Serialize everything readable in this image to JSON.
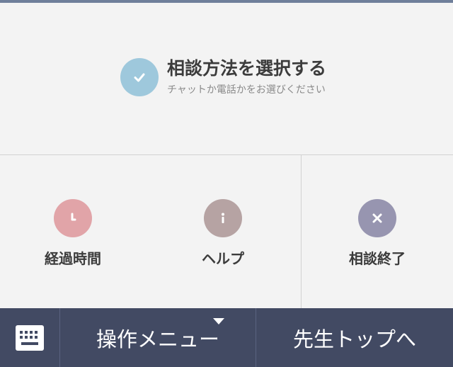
{
  "colors": {
    "check": "#9ec8dc",
    "elapsed": "#e1a4a8",
    "help": "#b6a3a3",
    "end": "#9795b0",
    "bottom_bar": "#424a63"
  },
  "select": {
    "title": "相談方法を選択する",
    "subtitle": "チャットか電話かをお選びください",
    "icon": "check-icon"
  },
  "actions": [
    {
      "label": "経過時間",
      "icon": "clock-icon"
    },
    {
      "label": "ヘルプ",
      "icon": "info-icon"
    },
    {
      "label": "相談終了",
      "icon": "close-icon"
    }
  ],
  "bottom_bar": {
    "keyboard_icon": "keyboard-icon",
    "menu_label": "操作メニュー",
    "top_label": "先生トップへ"
  }
}
